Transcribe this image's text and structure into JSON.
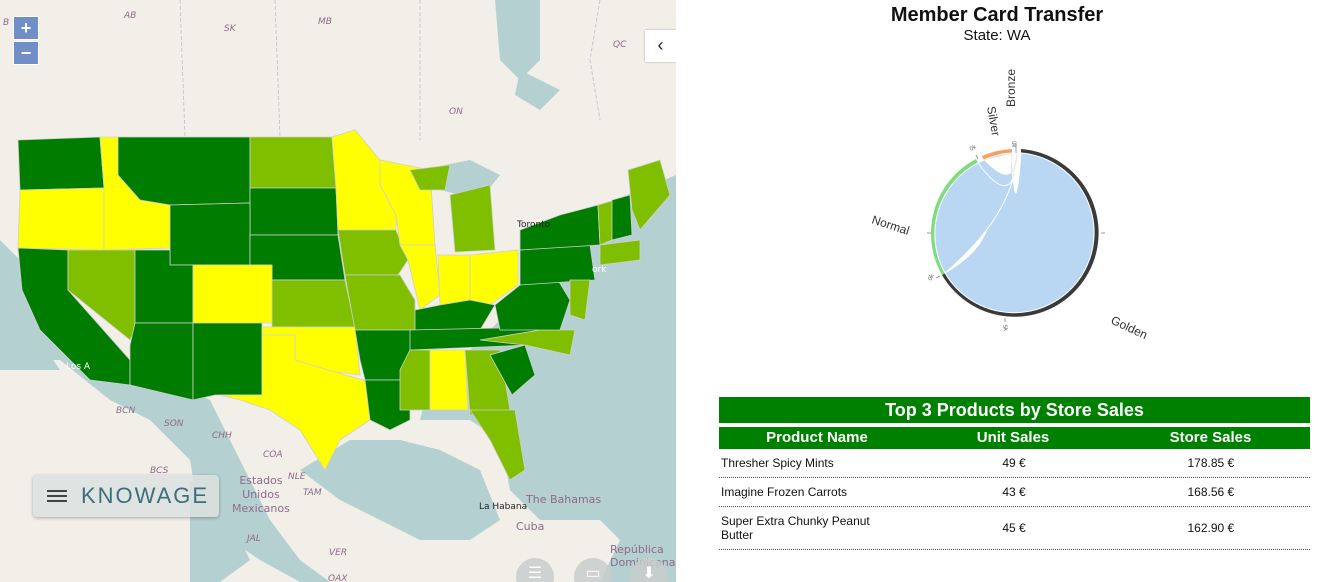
{
  "map": {
    "zoom_in": "+",
    "zoom_out": "−",
    "collapse_icon": "‹",
    "brand": "KNOWAGE",
    "labels": {
      "ab": "AB",
      "sk": "SK",
      "mb": "MB",
      "on": "ON",
      "qc": "QC",
      "bc": "B",
      "toronto": "Toronto",
      "nyk": "ork",
      "los": "Los A",
      "bcn": "BCN",
      "son": "SON",
      "chh": "CHH",
      "coa": "COA",
      "nle": "NLE",
      "tam": "TAM",
      "bcs": "BCS",
      "mexico": "Estados\nUnidos\nMexicanos",
      "jal": "JAL",
      "ver": "VER",
      "oax": "OAX",
      "bahamas": "The Bahamas",
      "habana": "La Habana",
      "cuba": "Cuba",
      "republica": "República\nDominicana"
    },
    "legend_colors": {
      "high": "#007d00",
      "mid": "#7fbf00",
      "low": "#ffff00"
    }
  },
  "chart": {
    "title": "Member Card Transfer",
    "subtitle": "State: WA",
    "ticks": {
      "zero": "0k",
      "five": "5k"
    }
  },
  "chart_data": {
    "type": "chord",
    "title": "Member Card Transfer",
    "subtitle": "State: WA",
    "groups": [
      {
        "name": "Golden",
        "color": "#3a3a3a"
      },
      {
        "name": "Normal",
        "color": "#7fdc7f"
      },
      {
        "name": "Silver",
        "color": "#f4a060"
      },
      {
        "name": "Bronze",
        "color": "#b9d6f2"
      }
    ],
    "tick_labels": [
      "0k",
      "5k"
    ]
  },
  "table": {
    "caption": "Top 3 Products by Store Sales",
    "columns": [
      "Product Name",
      "Unit Sales",
      "Store Sales"
    ],
    "rows": [
      [
        "Thresher Spicy Mints",
        "49 €",
        "178.85 €"
      ],
      [
        "Imagine Frozen Carrots",
        "43 €",
        "168.56 €"
      ],
      [
        "Super Extra Chunky Peanut Butter",
        "45 €",
        "162.90 €"
      ]
    ]
  }
}
